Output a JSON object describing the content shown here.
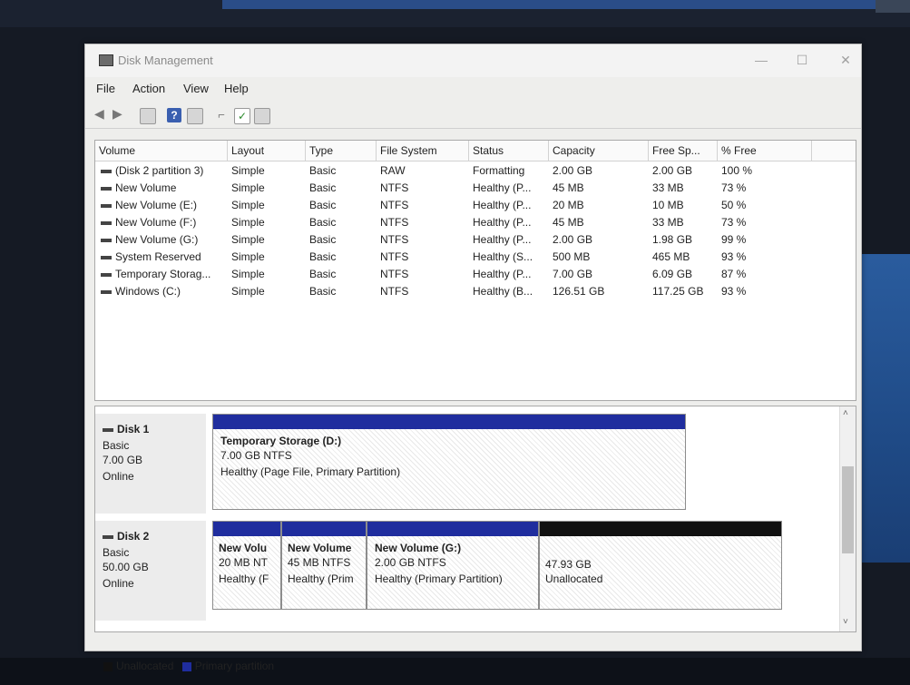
{
  "window": {
    "title": "Disk Management",
    "menu": [
      "File",
      "Action",
      "View",
      "Help"
    ]
  },
  "volume_list": {
    "columns": [
      "Volume",
      "Layout",
      "Type",
      "File System",
      "Status",
      "Capacity",
      "Free Sp...",
      "% Free"
    ],
    "rows": [
      [
        "(Disk 2 partition 3)",
        "Simple",
        "Basic",
        "RAW",
        "Formatting",
        "2.00 GB",
        "2.00 GB",
        "100 %"
      ],
      [
        "New Volume",
        "Simple",
        "Basic",
        "NTFS",
        "Healthy (P...",
        "45 MB",
        "33 MB",
        "73 %"
      ],
      [
        "New Volume (E:)",
        "Simple",
        "Basic",
        "NTFS",
        "Healthy (P...",
        "20 MB",
        "10 MB",
        "50 %"
      ],
      [
        "New Volume (F:)",
        "Simple",
        "Basic",
        "NTFS",
        "Healthy (P...",
        "45 MB",
        "33 MB",
        "73 %"
      ],
      [
        "New Volume (G:)",
        "Simple",
        "Basic",
        "NTFS",
        "Healthy (P...",
        "2.00 GB",
        "1.98 GB",
        "99 %"
      ],
      [
        "System Reserved",
        "Simple",
        "Basic",
        "NTFS",
        "Healthy (S...",
        "500 MB",
        "465 MB",
        "93 %"
      ],
      [
        "Temporary Storag...",
        "Simple",
        "Basic",
        "NTFS",
        "Healthy (P...",
        "7.00 GB",
        "6.09 GB",
        "87 %"
      ],
      [
        "Windows (C:)",
        "Simple",
        "Basic",
        "NTFS",
        "Healthy (B...",
        "126.51 GB",
        "117.25 GB",
        "93 %"
      ]
    ]
  },
  "disks": {
    "disk1": {
      "name": "Disk 1",
      "type": "Basic",
      "size": "7.00 GB",
      "state": "Online",
      "partition": {
        "title": "Temporary Storage  (D:)",
        "fs": "7.00 GB NTFS",
        "status": "Healthy (Page File, Primary Partition)"
      }
    },
    "disk2": {
      "name": "Disk 2",
      "type": "Basic",
      "size": "50.00 GB",
      "state": "Online",
      "p1": {
        "title": "New Volu",
        "fs": "20 MB NT",
        "status": "Healthy (F"
      },
      "p2": {
        "title": "New Volume",
        "fs": "45 MB NTFS",
        "status": "Healthy (Prim"
      },
      "p3": {
        "title": "New Volume  (G:)",
        "fs": "2.00 GB NTFS",
        "status": "Healthy (Primary Partition)"
      },
      "p4": {
        "size": "47.93 GB",
        "status": "Unallocated"
      }
    }
  },
  "legend": {
    "unallocated": "Unallocated",
    "primary": "Primary partition"
  },
  "colors": {
    "primary": "#1f2d9e",
    "unallocated": "#111111"
  }
}
